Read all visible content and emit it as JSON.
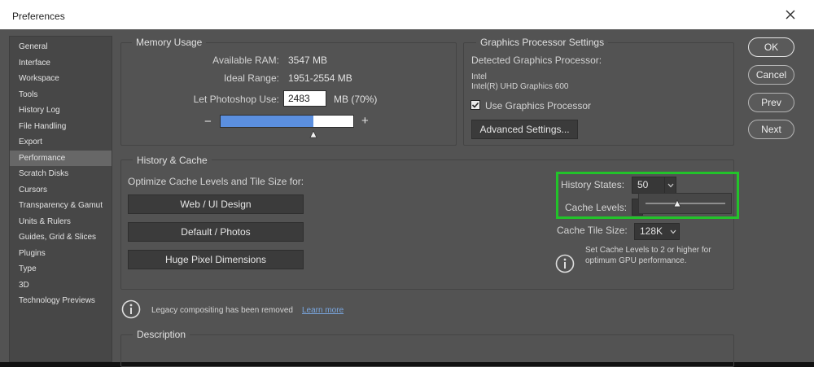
{
  "window": {
    "title": "Preferences"
  },
  "sidebar": {
    "items": [
      {
        "label": "General"
      },
      {
        "label": "Interface"
      },
      {
        "label": "Workspace"
      },
      {
        "label": "Tools"
      },
      {
        "label": "History Log"
      },
      {
        "label": "File Handling"
      },
      {
        "label": "Export"
      },
      {
        "label": "Performance",
        "active": true
      },
      {
        "label": "Scratch Disks"
      },
      {
        "label": "Cursors"
      },
      {
        "label": "Transparency & Gamut"
      },
      {
        "label": "Units & Rulers"
      },
      {
        "label": "Guides, Grid & Slices"
      },
      {
        "label": "Plugins"
      },
      {
        "label": "Type"
      },
      {
        "label": "3D"
      },
      {
        "label": "Technology Previews"
      }
    ]
  },
  "memory": {
    "title": "Memory Usage",
    "available_label": "Available RAM:",
    "available_value": "3547 MB",
    "ideal_label": "Ideal Range:",
    "ideal_value": "1951-2554 MB",
    "let_label": "Let Photoshop Use:",
    "let_value": "2483",
    "let_unit": "MB (70%)",
    "usage_fraction": 0.7,
    "minus": "−",
    "plus": "+"
  },
  "gpu": {
    "title": "Graphics Processor Settings",
    "detected_label": "Detected Graphics Processor:",
    "vendor": "Intel",
    "model": "Intel(R) UHD Graphics 600",
    "use_label": "Use Graphics Processor",
    "use_checked": true,
    "advanced_button": "Advanced Settings..."
  },
  "history_cache": {
    "title": "History & Cache",
    "optimize_label": "Optimize Cache Levels and Tile Size for:",
    "buttons": [
      "Web / UI Design",
      "Default / Photos",
      "Huge Pixel Dimensions"
    ],
    "history_states_label": "History States:",
    "history_states_value": "50",
    "cache_levels_label": "Cache Levels:",
    "history_slider_fraction": 0.4,
    "cache_tile_label": "Cache Tile Size:",
    "cache_tile_value": "128K",
    "gpu_note": "Set Cache Levels to 2 or higher for optimum GPU performance."
  },
  "legacy": {
    "text": "Legacy compositing has been removed",
    "link": "Learn more"
  },
  "description": {
    "title": "Description"
  },
  "actions": {
    "ok": "OK",
    "cancel": "Cancel",
    "prev": "Prev",
    "next": "Next"
  },
  "colors": {
    "highlight": "#22c32a",
    "bar_fill": "#5b8fdf",
    "background": "#535353"
  }
}
